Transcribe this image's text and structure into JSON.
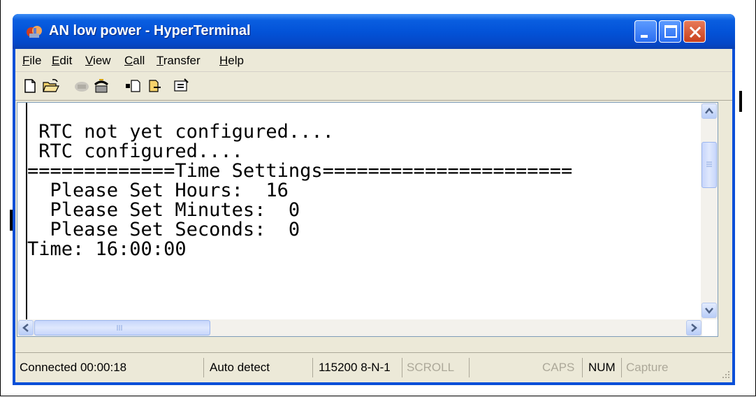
{
  "window": {
    "title": "AN low power - HyperTerminal",
    "app_icon": "hyperterminal-icon"
  },
  "menu": {
    "items": [
      {
        "label": "File",
        "mnemonic": "F"
      },
      {
        "label": "Edit",
        "mnemonic": "E"
      },
      {
        "label": "View",
        "mnemonic": "V"
      },
      {
        "label": "Call",
        "mnemonic": "C"
      },
      {
        "label": "Transfer",
        "mnemonic": "T"
      },
      {
        "label": "Help",
        "mnemonic": "H"
      }
    ]
  },
  "toolbar": {
    "icons": [
      "new-document-icon",
      "open-folder-icon",
      "disconnect-icon",
      "connect-phone-icon",
      "send-file-icon",
      "receive-file-icon",
      "properties-icon"
    ]
  },
  "terminal": {
    "lines": [
      "",
      " RTC not yet configured....",
      " RTC configured....",
      "=============Time Settings======================",
      "  Please Set Hours:  16",
      "  Please Set Minutes:  0",
      "  Please Set Seconds:  0",
      "Time: 16:00:00"
    ]
  },
  "status": {
    "connected": "Connected 00:00:18",
    "detect": "Auto detect",
    "settings": "115200 8-N-1",
    "scroll": "SCROLL",
    "caps": "CAPS",
    "num": "NUM",
    "capture": "Capture"
  },
  "colors": {
    "titlebar": "#0353d8",
    "close_button": "#c8401d",
    "chrome": "#ece9d8",
    "dim_status": "#aca899"
  }
}
